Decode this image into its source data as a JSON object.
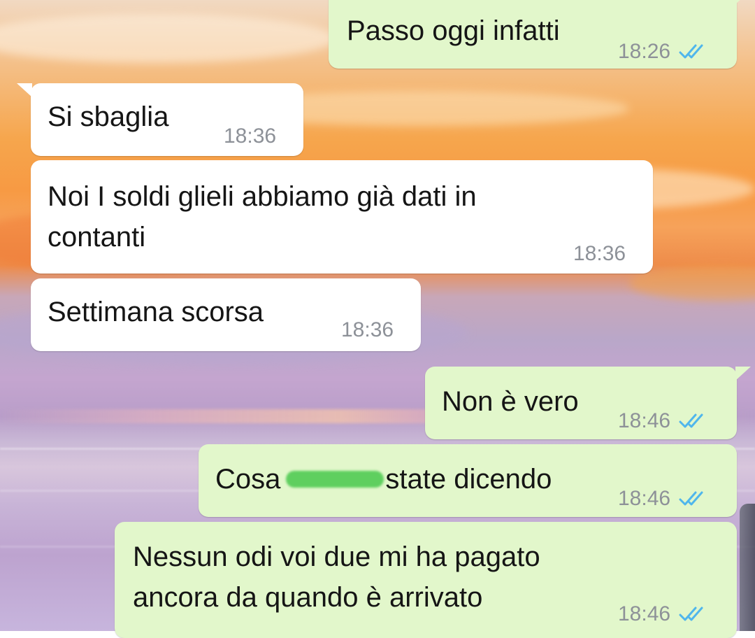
{
  "chat": {
    "messages": [
      {
        "direction": "out",
        "text": "Passo oggi infatti",
        "time": "18:26",
        "status": "read"
      },
      {
        "direction": "in",
        "text": "Si sbaglia",
        "time": "18:36"
      },
      {
        "direction": "in",
        "text_line1": "Noi I soldi glieli abbiamo già dati in",
        "text_line2": "contanti",
        "time": "18:36"
      },
      {
        "direction": "in",
        "text": "Settimana scorsa",
        "time": "18:36"
      },
      {
        "direction": "out",
        "text": "Non è vero",
        "time": "18:46",
        "status": "read"
      },
      {
        "direction": "out",
        "text_before": "Cosa",
        "text_after": "state dicendo",
        "redacted": true,
        "time": "18:46",
        "status": "read"
      },
      {
        "direction": "out",
        "text_line1": "Nessun odi voi due mi ha pagato",
        "text_line2": "ancora da quando è arrivato",
        "time": "18:46",
        "status": "read"
      }
    ]
  },
  "colors": {
    "incoming_bubble": "#ffffff",
    "outgoing_bubble": "#e2f7cb",
    "read_ticks": "#4fb6ec",
    "timestamp": "#8d9198",
    "redaction": "#5fcf5f"
  },
  "icons": {
    "read_status": "double-check-icon"
  }
}
